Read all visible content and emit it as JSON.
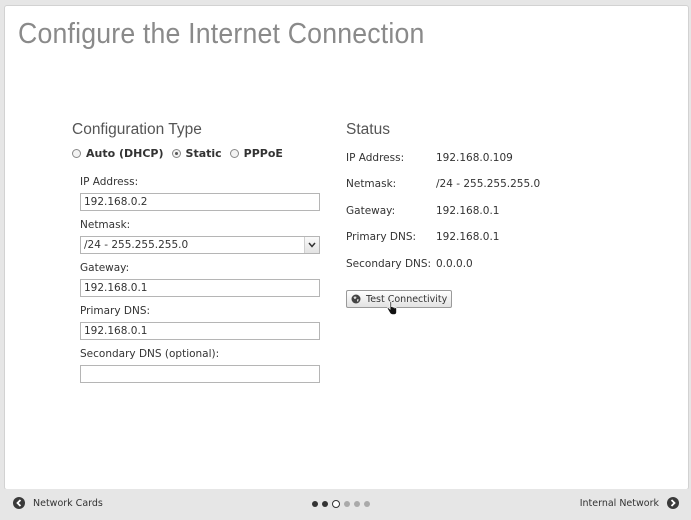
{
  "page": {
    "title": "Configure the Internet Connection"
  },
  "config": {
    "heading": "Configuration Type",
    "options": [
      {
        "label": "Auto (DHCP)",
        "checked": false
      },
      {
        "label": "Static",
        "checked": true
      },
      {
        "label": "PPPoE",
        "checked": false
      }
    ],
    "ip_label": "IP Address:",
    "ip_value": "192.168.0.2",
    "netmask_label": "Netmask:",
    "netmask_value": "/24 - 255.255.255.0",
    "gateway_label": "Gateway:",
    "gateway_value": "192.168.0.1",
    "primary_dns_label": "Primary DNS:",
    "primary_dns_value": "192.168.0.1",
    "secondary_dns_label": "Secondary DNS (optional):",
    "secondary_dns_value": ""
  },
  "status": {
    "heading": "Status",
    "ip_label": "IP Address:",
    "ip_value": "192.168.0.109",
    "netmask_label": "Netmask:",
    "netmask_value": "/24 - 255.255.255.0",
    "gateway_label": "Gateway:",
    "gateway_value": "192.168.0.1",
    "primary_dns_label": "Primary DNS:",
    "primary_dns_value": "192.168.0.1",
    "secondary_dns_label": "Secondary DNS:",
    "secondary_dns_value": "0.0.0.0",
    "test_button": "Test Connectivity"
  },
  "footer": {
    "back_label": "Network Cards",
    "next_label": "Internal Network",
    "steps_total": 6,
    "steps_current": 3
  },
  "icons": {
    "globe": "globe-icon",
    "cursor": "hand-cursor-icon",
    "back": "arrow-left-icon",
    "next": "arrow-right-icon"
  }
}
